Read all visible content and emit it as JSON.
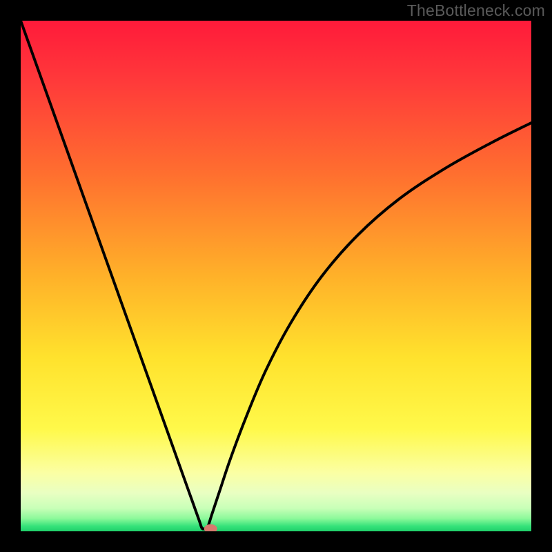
{
  "watermark": "TheBottleneck.com",
  "colors": {
    "background": "#000000",
    "curve": "#000000",
    "marker_fill": "#d77a6e",
    "marker_stroke": "#d77a6e",
    "gradient_stops": [
      {
        "offset": 0.0,
        "color": "#ff1a3a"
      },
      {
        "offset": 0.12,
        "color": "#ff3a3a"
      },
      {
        "offset": 0.3,
        "color": "#ff6f2f"
      },
      {
        "offset": 0.5,
        "color": "#ffb129"
      },
      {
        "offset": 0.66,
        "color": "#ffe22d"
      },
      {
        "offset": 0.8,
        "color": "#fff94a"
      },
      {
        "offset": 0.885,
        "color": "#fbffa3"
      },
      {
        "offset": 0.925,
        "color": "#e9ffc2"
      },
      {
        "offset": 0.955,
        "color": "#c8ffb8"
      },
      {
        "offset": 0.975,
        "color": "#8cf99a"
      },
      {
        "offset": 0.99,
        "color": "#35e27a"
      },
      {
        "offset": 1.0,
        "color": "#20d06b"
      }
    ]
  },
  "chart_data": {
    "type": "line",
    "title": "",
    "xlabel": "",
    "ylabel": "",
    "xlim": [
      0,
      100
    ],
    "ylim": [
      0,
      100
    ],
    "series": [
      {
        "name": "bottleneck-curve",
        "x": [
          0,
          3,
          6,
          9,
          12,
          15,
          18,
          21,
          24,
          27,
          30,
          31.5,
          33,
          34,
          35,
          35.5,
          36,
          36.5,
          37.5,
          39,
          41,
          44,
          48,
          53,
          59,
          66,
          74,
          83,
          92,
          100
        ],
        "y": [
          100,
          91.6,
          83.2,
          74.8,
          66.4,
          58.0,
          49.6,
          41.2,
          32.8,
          24.4,
          16.0,
          11.8,
          7.6,
          4.8,
          2.0,
          0.6,
          0.5,
          0.5,
          3.5,
          8.0,
          14.0,
          22.0,
          31.5,
          41.0,
          50.0,
          58.0,
          65.0,
          71.0,
          76.0,
          80.0
        ]
      }
    ],
    "marker": {
      "x": 37.2,
      "y": 0.5
    }
  }
}
